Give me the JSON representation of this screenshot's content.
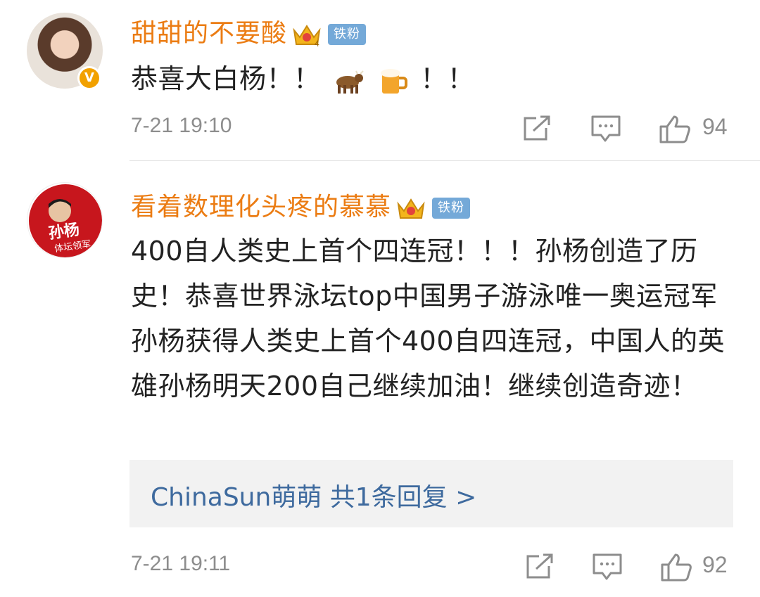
{
  "comments": [
    {
      "username": "甜甜的不要酸",
      "fan_badge": "铁粉",
      "crown_level": "4",
      "verified": true,
      "text_before_emoji": "恭喜大白杨！！",
      "emojis": [
        "ox-emoji",
        "beer-emoji"
      ],
      "text_after_emoji": "！！",
      "timestamp": "7-21 19:10",
      "like_count": "94"
    },
    {
      "username": "看着数理化头疼的慕慕",
      "fan_badge": "铁粉",
      "crown_level": "",
      "verified": false,
      "avatar_text": "孙杨",
      "avatar_subtext": "体坛领军",
      "text": "400自人类史上首个四连冠！！！孙杨创造了历史！恭喜世界泳坛top中国男子游泳唯一奥运冠军孙杨获得人类史上首个400自四连冠，中国人的英雄孙杨明天200自己继续加油！继续创造奇迹！",
      "reply_summary": "ChinaSun萌萌  共1条回复 >",
      "timestamp": "7-21 19:11",
      "like_count": "92"
    }
  ],
  "colors": {
    "username": "#eb7c13",
    "fan_badge_bg": "#74a9d8",
    "reply_link": "#3e6a9e",
    "meta": "#8d8d8d"
  }
}
